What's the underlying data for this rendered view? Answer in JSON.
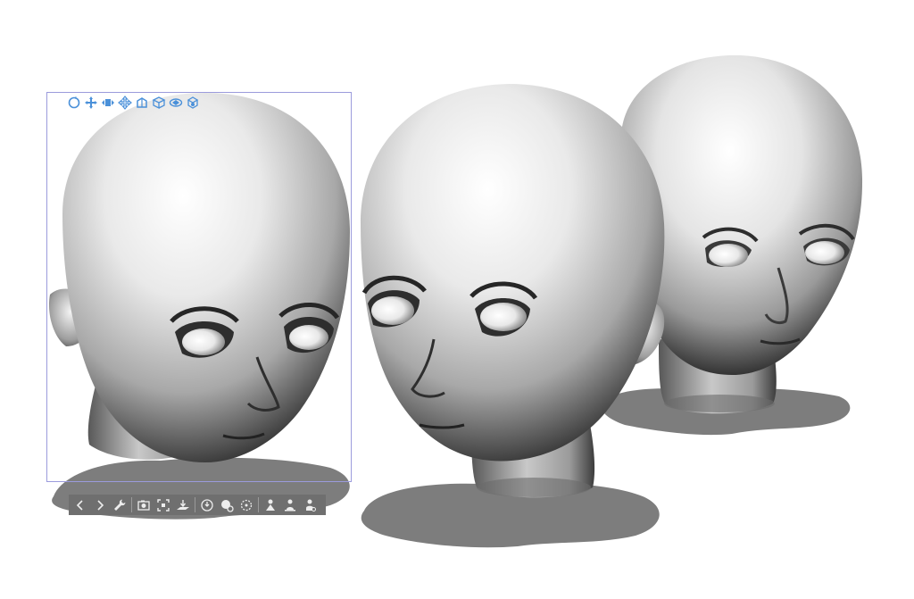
{
  "colors": {
    "manipulator_accent": "#4a90d9",
    "toolbar_bg": "#6f6f6f",
    "toolbar_icon": "#ededed",
    "selection_border": "#9b9bdc",
    "shadow": "#7d7d7d"
  },
  "scene": {
    "models": [
      {
        "name": "head-model-selected",
        "selected": true
      },
      {
        "name": "head-model-center",
        "selected": false
      },
      {
        "name": "head-model-right",
        "selected": false
      }
    ]
  },
  "manipulator": {
    "icons": [
      "rotate-camera-icon",
      "pan-camera-icon",
      "dolly-camera-icon",
      "move-icon",
      "rotate-object-icon",
      "rotate-x-icon",
      "rotate-y-icon",
      "rotate-z-icon"
    ]
  },
  "toolbar": {
    "icons": [
      "previous-icon",
      "next-icon",
      "wrench-icon",
      "camera-icon",
      "fit-view-icon",
      "floor-snap-icon",
      "reset-pose-icon",
      "pose-settings-icon",
      "rotate-reset-icon",
      "pose-preset-icon",
      "register-pose-icon",
      "apply-material-icon"
    ]
  }
}
